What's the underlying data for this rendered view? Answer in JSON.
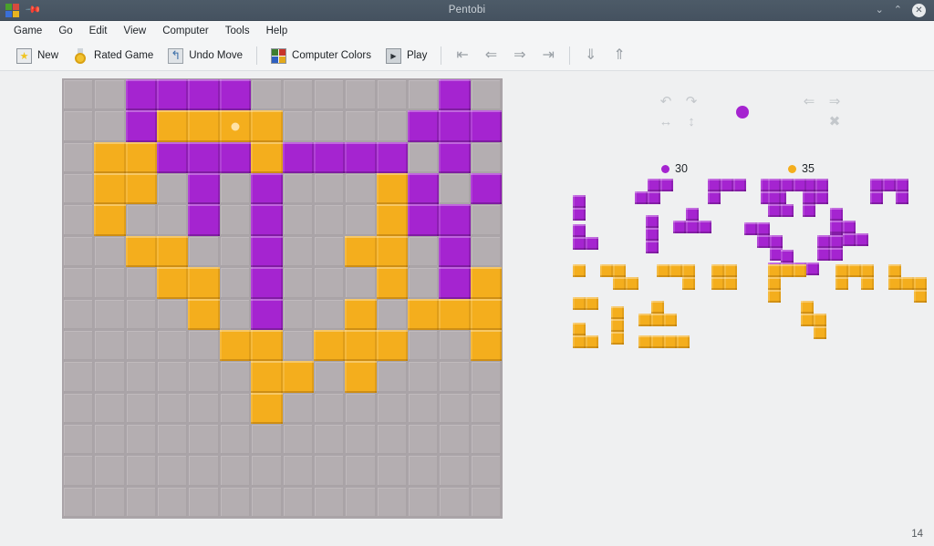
{
  "window": {
    "title": "Pentobi",
    "logo_icon": "pentobi-logo-icon",
    "pin_icon": "pin-icon",
    "minimize_icon": "chevron-down-icon",
    "maximize_icon": "chevron-up-icon",
    "close_icon": "close-icon"
  },
  "menubar": {
    "items": [
      {
        "label": "Game"
      },
      {
        "label": "Go"
      },
      {
        "label": "Edit"
      },
      {
        "label": "View"
      },
      {
        "label": "Computer"
      },
      {
        "label": "Tools"
      },
      {
        "label": "Help"
      }
    ]
  },
  "toolbar": {
    "items": [
      {
        "label": "New",
        "icon": "new-game-icon"
      },
      {
        "label": "Rated Game",
        "icon": "medal-icon"
      },
      {
        "label": "Undo Move",
        "icon": "undo-icon"
      },
      {
        "label": "Computer Colors",
        "icon": "computer-colors-icon"
      },
      {
        "label": "Play",
        "icon": "play-icon"
      }
    ],
    "nav": [
      {
        "icon": "go-first-icon",
        "glyph": "⇤"
      },
      {
        "icon": "go-back-icon",
        "glyph": "⇐"
      },
      {
        "icon": "go-forward-icon",
        "glyph": "⇒"
      },
      {
        "icon": "go-last-icon",
        "glyph": "⇥"
      },
      {
        "icon": "go-down-icon",
        "glyph": "⇓"
      },
      {
        "icon": "go-up-icon",
        "glyph": "⇑"
      }
    ]
  },
  "board": {
    "size": 14,
    "colors": {
      "empty": "#b4aeb1",
      "purple": "#a524d0",
      "orange": "#f4ae1d"
    },
    "marker_cell": {
      "row": 1,
      "col": 5
    },
    "cells": [
      [
        "e",
        "e",
        "p",
        "p",
        "p",
        "p",
        "e",
        "e",
        "e",
        "e",
        "e",
        "e",
        "p",
        "e"
      ],
      [
        "e",
        "e",
        "p",
        "o",
        "o",
        "o",
        "o",
        "e",
        "e",
        "e",
        "e",
        "p",
        "p",
        "p"
      ],
      [
        "e",
        "o",
        "o",
        "p",
        "p",
        "p",
        "o",
        "p",
        "p",
        "p",
        "p",
        "e",
        "p",
        "e"
      ],
      [
        "e",
        "o",
        "o",
        "e",
        "p",
        "e",
        "p",
        "e",
        "e",
        "e",
        "o",
        "p",
        "e",
        "p"
      ],
      [
        "e",
        "o",
        "e",
        "e",
        "p",
        "e",
        "p",
        "e",
        "e",
        "e",
        "o",
        "p",
        "p",
        "e"
      ],
      [
        "e",
        "e",
        "o",
        "o",
        "e",
        "e",
        "p",
        "e",
        "e",
        "o",
        "o",
        "e",
        "p",
        "e"
      ],
      [
        "e",
        "e",
        "e",
        "o",
        "o",
        "e",
        "p",
        "e",
        "e",
        "e",
        "o",
        "e",
        "p",
        "o"
      ],
      [
        "e",
        "e",
        "e",
        "e",
        "o",
        "e",
        "p",
        "e",
        "e",
        "o",
        "e",
        "o",
        "o",
        "o"
      ],
      [
        "e",
        "e",
        "e",
        "e",
        "e",
        "o",
        "o",
        "e",
        "o",
        "o",
        "o",
        "e",
        "e",
        "o"
      ],
      [
        "e",
        "e",
        "e",
        "e",
        "e",
        "e",
        "o",
        "o",
        "e",
        "o",
        "e",
        "e",
        "e",
        "e"
      ],
      [
        "e",
        "e",
        "e",
        "e",
        "e",
        "e",
        "o",
        "e",
        "e",
        "e",
        "e",
        "e",
        "e",
        "e"
      ],
      [
        "e",
        "e",
        "e",
        "e",
        "e",
        "e",
        "e",
        "e",
        "e",
        "e",
        "e",
        "e",
        "e",
        "e"
      ],
      [
        "e",
        "e",
        "e",
        "e",
        "e",
        "e",
        "e",
        "e",
        "e",
        "e",
        "e",
        "e",
        "e",
        "e"
      ],
      [
        "e",
        "e",
        "e",
        "e",
        "e",
        "e",
        "e",
        "e",
        "e",
        "e",
        "e",
        "e",
        "e",
        "e"
      ]
    ]
  },
  "panel": {
    "transform_controls_left": [
      {
        "icon": "rotate-left-icon",
        "glyph": "↶"
      },
      {
        "icon": "rotate-right-icon",
        "glyph": "↷"
      },
      {
        "icon": "flip-horizontal-icon",
        "glyph": "↔"
      },
      {
        "icon": "flip-vertical-icon",
        "glyph": "↕"
      }
    ],
    "transform_controls_right": [
      {
        "icon": "move-left-icon",
        "glyph": "⇐"
      },
      {
        "icon": "move-right-icon",
        "glyph": "⇒"
      },
      {
        "icon": "cancel-piece-icon",
        "glyph": "✖"
      }
    ],
    "turn_indicator": {
      "color": "#a524d0",
      "name": "purple-turn-indicator"
    },
    "scores": [
      {
        "player": "purple",
        "color": "#a524d0",
        "value": "30"
      },
      {
        "player": "orange",
        "color": "#f4ae1d",
        "value": "35"
      }
    ],
    "move_counter": "14"
  },
  "trays": {
    "purple_left": {
      "color": "purple",
      "pieces": [
        {
          "name": "domino-piece",
          "cells": [
            [
              0,
              0
            ],
            [
              1,
              0
            ]
          ]
        },
        {
          "name": "l-corner-piece",
          "cells": [
            [
              0,
              0
            ],
            [
              1,
              0
            ],
            [
              1,
              1
            ]
          ]
        },
        {
          "name": "s-step-piece",
          "cells": [
            [
              0,
              1
            ],
            [
              0,
              2
            ],
            [
              1,
              0
            ],
            [
              1,
              1
            ]
          ]
        },
        {
          "name": "i3-vertical-piece",
          "cells": [
            [
              0,
              0
            ],
            [
              1,
              0
            ],
            [
              2,
              0
            ]
          ]
        },
        {
          "name": "t-piece",
          "cells": [
            [
              0,
              1
            ],
            [
              1,
              0
            ],
            [
              1,
              1
            ],
            [
              1,
              2
            ]
          ]
        },
        {
          "name": "l4-piece",
          "cells": [
            [
              0,
              0
            ],
            [
              0,
              1
            ],
            [
              0,
              2
            ],
            [
              1,
              0
            ]
          ]
        }
      ]
    },
    "purple_mid": {
      "color": "purple",
      "pieces": [
        {
          "name": "square-piece",
          "cells": [
            [
              0,
              0
            ],
            [
              0,
              1
            ],
            [
              1,
              0
            ],
            [
              1,
              1
            ]
          ]
        },
        {
          "name": "w-stair-piece",
          "cells": [
            [
              0,
              0
            ],
            [
              0,
              1
            ],
            [
              1,
              1
            ],
            [
              1,
              2
            ],
            [
              2,
              2
            ]
          ]
        },
        {
          "name": "p-piece",
          "cells": [
            [
              0,
              0
            ],
            [
              0,
              1
            ],
            [
              1,
              0
            ],
            [
              1,
              1
            ],
            [
              2,
              0
            ]
          ]
        },
        {
          "name": "z-piece",
          "cells": [
            [
              0,
              1
            ],
            [
              1,
              0
            ],
            [
              1,
              1
            ],
            [
              2,
              0
            ],
            [
              2,
              1
            ]
          ]
        }
      ]
    },
    "purple_right": {
      "color": "purple",
      "pieces": [
        {
          "name": "u-block-piece",
          "cells": [
            [
              0,
              0
            ],
            [
              0,
              1
            ],
            [
              0,
              2
            ],
            [
              1,
              0
            ],
            [
              2,
              0
            ],
            [
              2,
              1
            ]
          ]
        },
        {
          "name": "z5-piece",
          "cells": [
            [
              0,
              0
            ],
            [
              1,
              0
            ],
            [
              1,
              1
            ],
            [
              2,
              1
            ],
            [
              2,
              2
            ]
          ]
        },
        {
          "name": "u-piece",
          "cells": [
            [
              0,
              0
            ],
            [
              0,
              1
            ],
            [
              0,
              2
            ],
            [
              1,
              0
            ],
            [
              1,
              2
            ]
          ]
        },
        {
          "name": "long-l-piece",
          "cells": [
            [
              0,
              1
            ],
            [
              1,
              0
            ],
            [
              1,
              1
            ],
            [
              1,
              2
            ],
            [
              1,
              3
            ]
          ]
        }
      ]
    },
    "orange_left": {
      "color": "orange",
      "pieces": [
        {
          "name": "single-piece",
          "cells": [
            [
              0,
              0
            ]
          ]
        },
        {
          "name": "s-step-piece",
          "cells": [
            [
              0,
              0
            ],
            [
              0,
              1
            ],
            [
              1,
              1
            ],
            [
              1,
              2
            ]
          ]
        },
        {
          "name": "l4-corner-piece",
          "cells": [
            [
              0,
              0
            ],
            [
              0,
              1
            ],
            [
              0,
              2
            ],
            [
              1,
              2
            ]
          ]
        },
        {
          "name": "square-piece",
          "cells": [
            [
              0,
              0
            ],
            [
              0,
              1
            ],
            [
              1,
              0
            ],
            [
              1,
              1
            ]
          ]
        },
        {
          "name": "domino-piece",
          "cells": [
            [
              0,
              0
            ],
            [
              0,
              1
            ]
          ]
        },
        {
          "name": "l-corner-piece",
          "cells": [
            [
              0,
              0
            ],
            [
              1,
              0
            ],
            [
              1,
              1
            ]
          ]
        },
        {
          "name": "i3-vertical-piece",
          "cells": [
            [
              0,
              0
            ],
            [
              1,
              0
            ],
            [
              2,
              0
            ]
          ]
        },
        {
          "name": "t-piece",
          "cells": [
            [
              0,
              1
            ],
            [
              1,
              0
            ],
            [
              1,
              1
            ],
            [
              1,
              2
            ]
          ]
        },
        {
          "name": "i4-piece",
          "cells": [
            [
              0,
              0
            ],
            [
              0,
              1
            ],
            [
              0,
              2
            ],
            [
              0,
              3
            ]
          ]
        }
      ]
    },
    "orange_right": {
      "color": "orange",
      "pieces": [
        {
          "name": "u-block-piece",
          "cells": [
            [
              0,
              0
            ],
            [
              0,
              1
            ],
            [
              0,
              2
            ],
            [
              1,
              0
            ],
            [
              2,
              0
            ]
          ]
        },
        {
          "name": "u-piece",
          "cells": [
            [
              0,
              0
            ],
            [
              0,
              1
            ],
            [
              0,
              2
            ],
            [
              1,
              0
            ],
            [
              1,
              2
            ]
          ]
        },
        {
          "name": "n-piece",
          "cells": [
            [
              0,
              0
            ],
            [
              1,
              0
            ],
            [
              1,
              1
            ],
            [
              2,
              1
            ]
          ]
        },
        {
          "name": "z5-piece",
          "cells": [
            [
              0,
              0
            ],
            [
              1,
              0
            ],
            [
              1,
              1
            ],
            [
              1,
              2
            ],
            [
              2,
              2
            ]
          ]
        },
        {
          "name": "i5-piece",
          "cells": [
            [
              0,
              0
            ],
            [
              1,
              0
            ],
            [
              2,
              0
            ],
            [
              3,
              0
            ],
            [
              4,
              0
            ]
          ]
        }
      ]
    }
  }
}
